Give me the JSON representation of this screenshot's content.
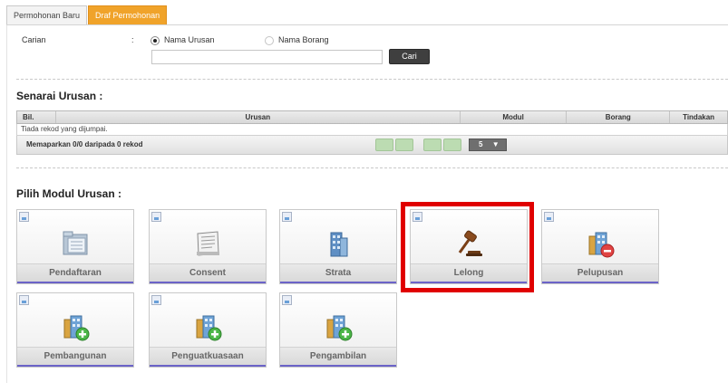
{
  "tabs": [
    {
      "label": "Permohonan Baru",
      "active": false
    },
    {
      "label": "Draf Permohonan",
      "active": true
    }
  ],
  "search": {
    "label": "Carian",
    "colon": ":",
    "options": [
      {
        "label": "Nama Urusan",
        "selected": true
      },
      {
        "label": "Nama Borang",
        "selected": false
      }
    ],
    "input_value": "",
    "button": "Cari"
  },
  "list": {
    "title": "Senarai Urusan :",
    "columns": [
      "Bil.",
      "Urusan",
      "Modul",
      "Borang",
      "Tindakan"
    ],
    "empty_message": "Tiada rekod yang dijumpai.",
    "summary": "Memaparkan 0/0 daripada 0 rekod",
    "page_size": "5",
    "page_size_arrow": "▼"
  },
  "modules": {
    "title": "Pilih Modul Urusan :",
    "items": [
      {
        "label": "Pendaftaran",
        "icon": "folder-icon"
      },
      {
        "label": "Consent",
        "icon": "document-icon"
      },
      {
        "label": "Strata",
        "icon": "building-icon"
      },
      {
        "label": "Lelong",
        "icon": "gavel-icon"
      },
      {
        "label": "Pelupusan",
        "icon": "building-remove-icon"
      },
      {
        "label": "Pembangunan",
        "icon": "building-add-icon"
      },
      {
        "label": "Penguatkuasaan",
        "icon": "building-add-icon"
      },
      {
        "label": "Pengambilan",
        "icon": "building-add-icon"
      }
    ],
    "highlighted": "Lelong"
  },
  "colors": {
    "active_tab": "#f0a32a",
    "highlight": "#e00000",
    "tile_underline": "#6b63c8",
    "pager_button": "#bcdcb2"
  }
}
